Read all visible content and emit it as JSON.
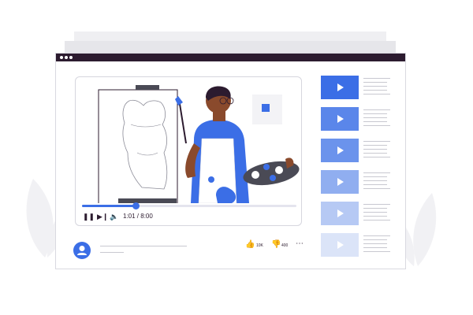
{
  "window": {
    "titlebar_color": "#2c1b2f",
    "dots": [
      "window-dot",
      "window-dot",
      "window-dot"
    ]
  },
  "player": {
    "progress_fraction": 0.25,
    "controls": {
      "pause_icon": "pause-icon",
      "next_icon": "skip-next-icon",
      "volume_icon": "volume-icon"
    },
    "time": "1:01 / 8:00"
  },
  "below_video": {
    "likes": "10K",
    "dislikes": "400",
    "more_icon": "more-icon"
  },
  "sidebar": {
    "items": [
      {
        "color": "#3b6ee6"
      },
      {
        "color": "#5a86ea"
      },
      {
        "color": "#6b93ec"
      },
      {
        "color": "#90aef0"
      },
      {
        "color": "#b6c9f4"
      },
      {
        "color": "#dbe4f8"
      }
    ]
  },
  "colors": {
    "accent": "#3b6ee6",
    "dark": "#2c1b2f"
  }
}
